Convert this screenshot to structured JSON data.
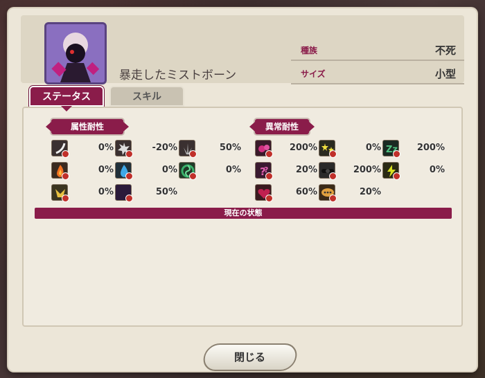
{
  "monster": {
    "name": "暴走したミストボーン",
    "info": [
      {
        "label": "種族",
        "value": "不死"
      },
      {
        "label": "サイズ",
        "value": "小型"
      }
    ]
  },
  "tabs": [
    {
      "label": "ステータス",
      "active": true
    },
    {
      "label": "スキル",
      "active": false
    }
  ],
  "sections": {
    "attribute_title": "属性耐性",
    "abnormal_title": "異常耐性",
    "current_state_title": "現在の状態"
  },
  "attribute_resistances": [
    {
      "icon": "slash-icon",
      "value": "0%"
    },
    {
      "icon": "burst-icon",
      "value": "-20%"
    },
    {
      "icon": "spike-icon",
      "value": "50%"
    },
    {
      "icon": "fire-icon",
      "value": "0%"
    },
    {
      "icon": "water-icon",
      "value": "0%"
    },
    {
      "icon": "wind-icon",
      "value": "0%"
    },
    {
      "icon": "light-icon",
      "value": "0%"
    },
    {
      "icon": "dark-icon",
      "value": "50%"
    }
  ],
  "abnormal_resistances": [
    {
      "icon": "poison-icon",
      "value": "200%"
    },
    {
      "icon": "stun-icon",
      "value": "0%"
    },
    {
      "icon": "sleep-icon",
      "value": "200%"
    },
    {
      "icon": "confusion-icon",
      "value": "20%"
    },
    {
      "icon": "blind-icon",
      "value": "200%"
    },
    {
      "icon": "paralysis-icon",
      "value": "0%"
    },
    {
      "icon": "charm-icon",
      "value": "60%"
    },
    {
      "icon": "silence-icon",
      "value": "20%"
    }
  ],
  "buttons": {
    "close": "閉じる"
  },
  "colors": {
    "accent": "#8a1c4a",
    "panel": "#ece6d8"
  }
}
